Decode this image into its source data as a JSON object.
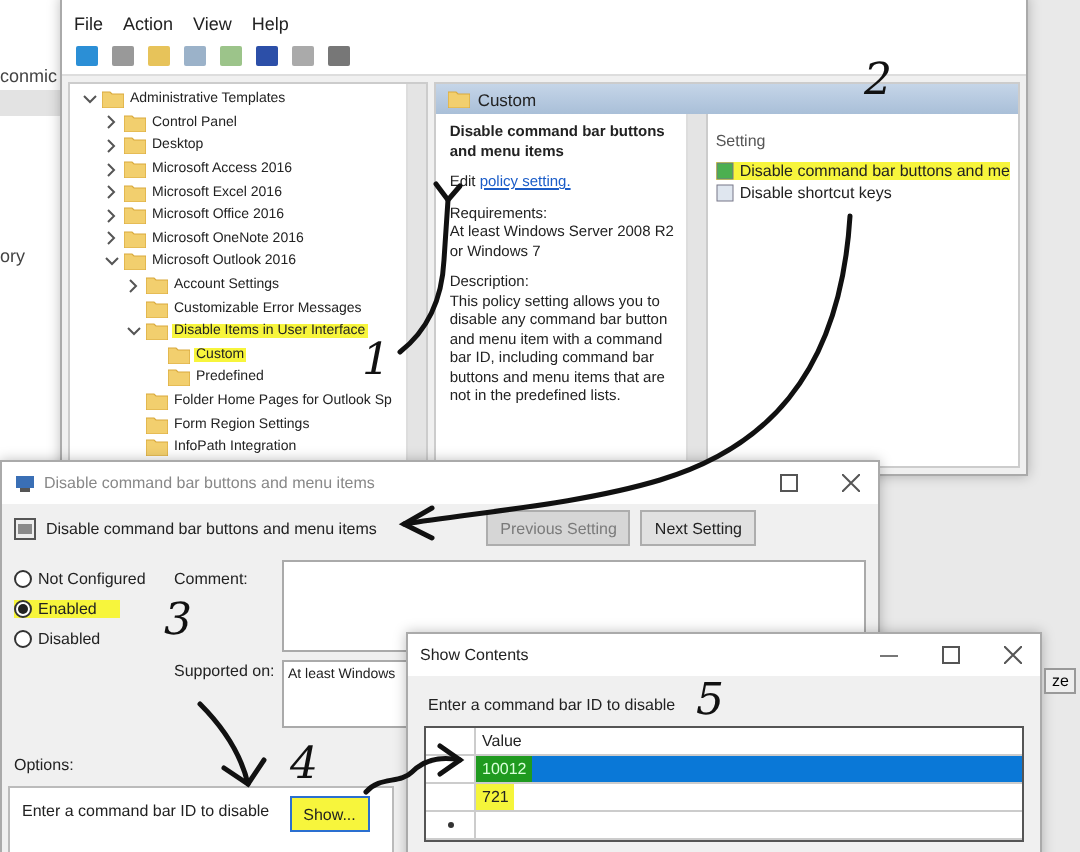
{
  "background_window": {
    "texts": [
      "conmic",
      "ory"
    ]
  },
  "editor": {
    "menu": [
      "File",
      "Action",
      "View",
      "Help"
    ],
    "tree": [
      {
        "label": "Administrative Templates",
        "expandable": true,
        "expanded": true,
        "highlighted": false,
        "children": [
          {
            "label": "Control Panel",
            "expandable": true,
            "expanded": false,
            "highlighted": false
          },
          {
            "label": "Desktop",
            "expandable": true,
            "expanded": false,
            "highlighted": false
          },
          {
            "label": "Microsoft Access 2016",
            "expandable": true,
            "expanded": false,
            "highlighted": false
          },
          {
            "label": "Microsoft Excel 2016",
            "expandable": true,
            "expanded": false,
            "highlighted": false
          },
          {
            "label": "Microsoft Office 2016",
            "expandable": true,
            "expanded": false,
            "highlighted": false
          },
          {
            "label": "Microsoft OneNote 2016",
            "expandable": true,
            "expanded": false,
            "highlighted": false
          },
          {
            "label": "Microsoft Outlook 2016",
            "expandable": true,
            "expanded": true,
            "highlighted": false,
            "children": [
              {
                "label": "Account Settings",
                "expandable": true,
                "expanded": false,
                "highlighted": false
              },
              {
                "label": "Customizable Error Messages",
                "highlighted": false
              },
              {
                "label": "Disable Items in User Interface",
                "expandable": true,
                "expanded": true,
                "highlighted": true,
                "children": [
                  {
                    "label": "Custom",
                    "highlighted": true
                  },
                  {
                    "label": "Predefined",
                    "highlighted": false
                  }
                ]
              },
              {
                "label": "Folder Home Pages for Outlook Sp",
                "highlighted": false
              },
              {
                "label": "Form Region Settings",
                "highlighted": false
              },
              {
                "label": "InfoPath Integration",
                "highlighted": false
              }
            ]
          }
        ]
      }
    ],
    "pane_header": "Custom",
    "details": {
      "title": "Disable command bar buttons and menu items",
      "edit_prefix": "Edit",
      "edit_link": "policy setting.",
      "requirements_label": "Requirements:",
      "requirements": "At least Windows Server 2008 R2 or Windows 7",
      "description_label": "Description:",
      "description": "This policy setting allows you to disable any command bar button and menu item with a command bar ID, including command bar buttons and menu items that are not in the predefined lists."
    },
    "settings_header": "Setting",
    "settings": [
      {
        "label": "Disable command bar buttons and me",
        "highlighted": true,
        "enabled": true
      },
      {
        "label": "Disable shortcut keys",
        "highlighted": false,
        "enabled": false
      }
    ]
  },
  "policy_dialog": {
    "title": "Disable command bar buttons and menu items",
    "heading": "Disable command bar buttons and menu items",
    "previous_button": {
      "label": "Previous Setting",
      "disabled": true
    },
    "next_button": {
      "label": "Next Setting",
      "disabled": false
    },
    "states": [
      {
        "label": "Not Configured",
        "selected": false,
        "highlighted": false
      },
      {
        "label": "Enabled",
        "selected": true,
        "highlighted": true
      },
      {
        "label": "Disabled",
        "selected": false,
        "highlighted": false
      }
    ],
    "comment_label": "Comment:",
    "supported_label": "Supported on:",
    "supported_value": "At least Windows",
    "options_label": "Options:",
    "option_text": "Enter a command bar ID to disable",
    "show_button": {
      "label": "Show...",
      "highlighted": true
    }
  },
  "show_contents": {
    "title": "Show Contents",
    "prompt": "Enter a command bar ID to disable",
    "column": "Value",
    "rows": [
      {
        "value": "10012",
        "selected": true,
        "color": "#1f9a1f"
      },
      {
        "value": "721",
        "selected": false,
        "color": "#f5f53a"
      },
      {
        "value": "",
        "selected": false
      }
    ]
  },
  "right_button": "ze",
  "annotations": [
    "1",
    "2",
    "3",
    "4",
    "5"
  ]
}
